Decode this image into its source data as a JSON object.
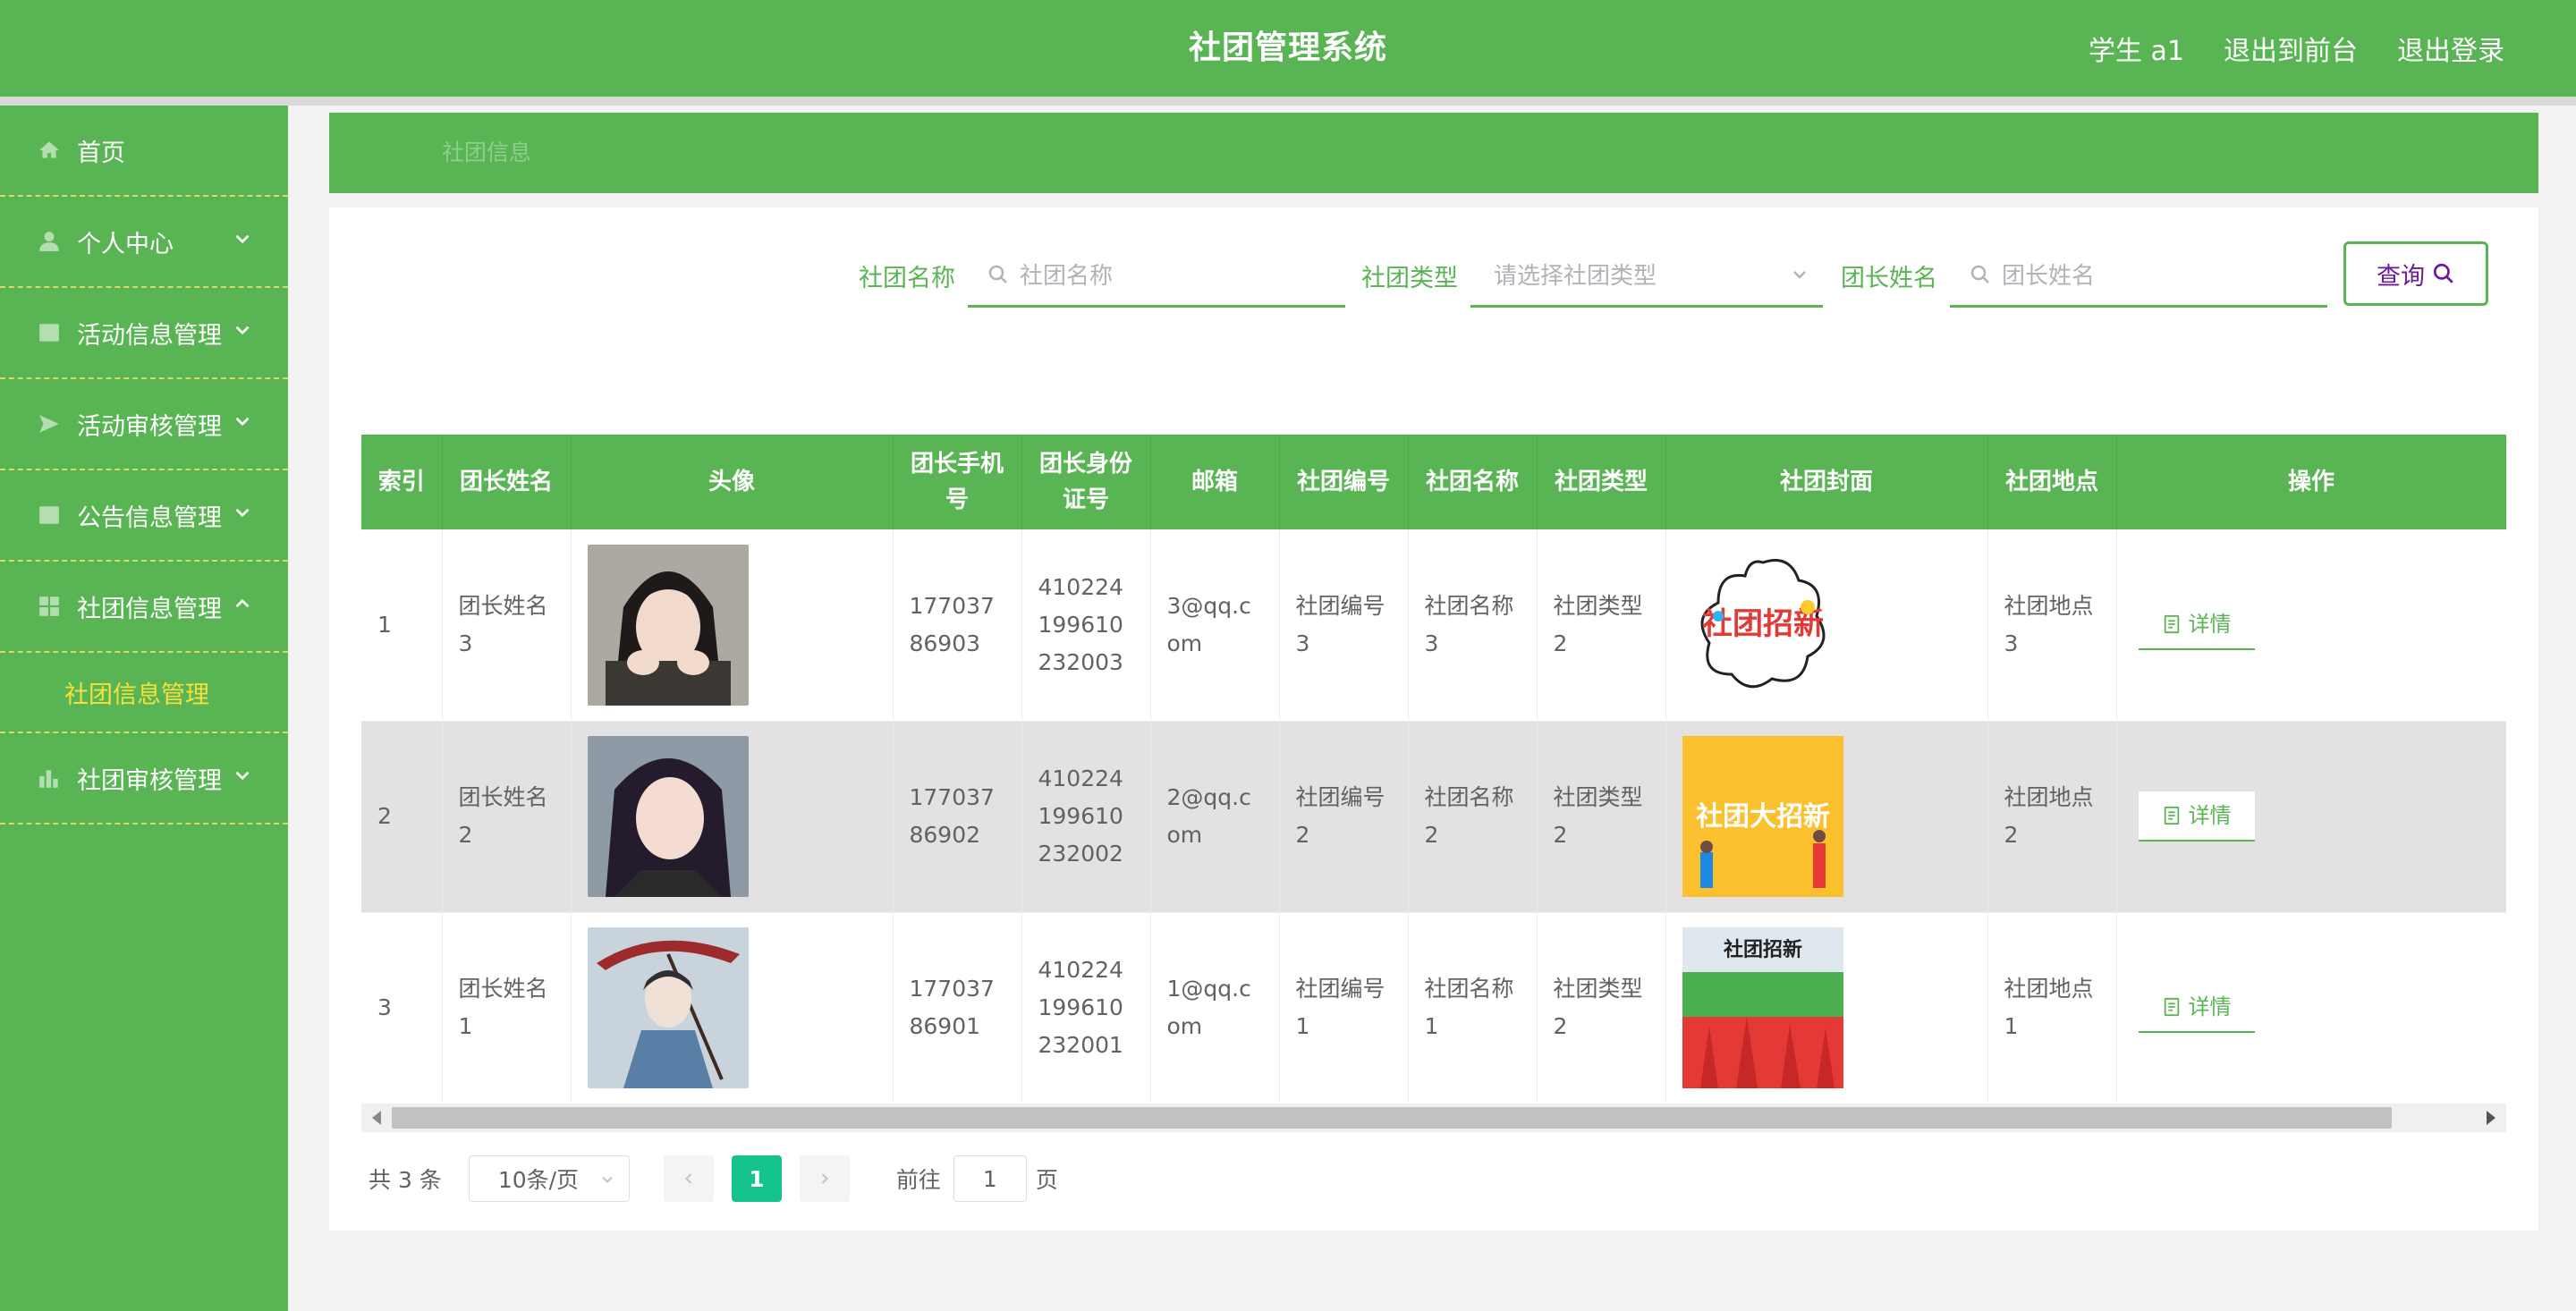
{
  "header": {
    "title": "社团管理系统",
    "user": "学生 a1",
    "to_frontend": "退出到前台",
    "logout": "退出登录"
  },
  "sidebar": {
    "items": [
      {
        "label": "首页",
        "icon": "home-icon"
      },
      {
        "label": "个人中心",
        "icon": "user-icon"
      },
      {
        "label": "活动信息管理",
        "icon": "grid-icon"
      },
      {
        "label": "活动审核管理",
        "icon": "send-icon"
      },
      {
        "label": "公告信息管理",
        "icon": "grid-icon"
      },
      {
        "label": "社团信息管理",
        "icon": "grid-icon"
      },
      {
        "label": "社团审核管理",
        "icon": "chart-icon"
      }
    ],
    "submenu": "社团信息管理"
  },
  "breadcrumb": "社团信息",
  "search": {
    "name_label": "社团名称",
    "name_placeholder": "社团名称",
    "type_label": "社团类型",
    "type_placeholder": "请选择社团类型",
    "leader_label": "团长姓名",
    "leader_placeholder": "团长姓名",
    "query_label": "查询"
  },
  "table": {
    "headers": [
      "索引",
      "团长姓名",
      "头像",
      "团长手机号",
      "团长身份证号",
      "邮箱",
      "社团编号",
      "社团名称",
      "社团类型",
      "社团封面",
      "社团地点",
      "操作"
    ],
    "rows": [
      {
        "index": "1",
        "leader": "团长姓名3",
        "phone": "17703786903",
        "idcard": "410224199610232003",
        "email": "3@qq.com",
        "code": "社团编号3",
        "name": "社团名称3",
        "type": "社团类型2",
        "place": "社团地点3",
        "cover_text": "社团招新"
      },
      {
        "index": "2",
        "leader": "团长姓名2",
        "phone": "17703786902",
        "idcard": "410224199610232002",
        "email": "2@qq.com",
        "code": "社团编号2",
        "name": "社团名称2",
        "type": "社团类型2",
        "place": "社团地点2",
        "cover_text": "社团大招新"
      },
      {
        "index": "3",
        "leader": "团长姓名1",
        "phone": "17703786901",
        "idcard": "410224199610232001",
        "email": "1@qq.com",
        "code": "社团编号1",
        "name": "社团名称1",
        "type": "社团类型2",
        "place": "社团地点1",
        "cover_text": "社团招新"
      }
    ],
    "detail_label": "详情"
  },
  "pagination": {
    "total": "共 3 条",
    "page_size": "10条/页",
    "current": "1",
    "goto_prefix": "前往",
    "goto_value": "1",
    "goto_suffix": "页"
  },
  "colors": {
    "primary": "#59b454",
    "submenu_active": "#f5e13c",
    "page_active": "#14c28c"
  }
}
